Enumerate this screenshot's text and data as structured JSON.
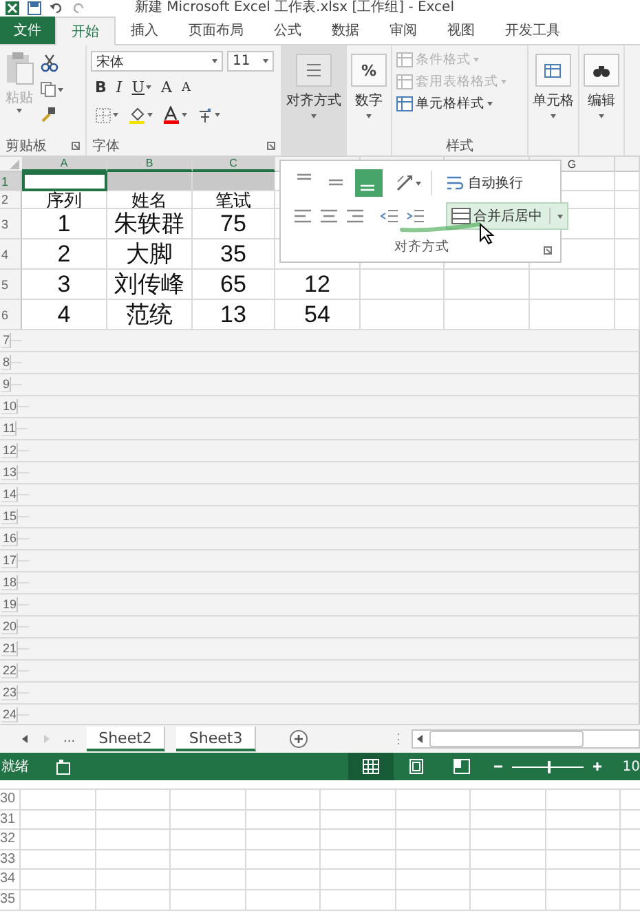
{
  "window": {
    "title": "新建 Microsoft Excel 工作表.xlsx  [工作组] - Excel"
  },
  "ribbon_tabs": [
    {
      "label": "文件",
      "kind": "file",
      "selected": false
    },
    {
      "label": "开始",
      "kind": "tab",
      "selected": true
    },
    {
      "label": "插入",
      "kind": "tab",
      "selected": false
    },
    {
      "label": "页面布局",
      "kind": "tab",
      "selected": false
    },
    {
      "label": "公式",
      "kind": "tab",
      "selected": false
    },
    {
      "label": "数据",
      "kind": "tab",
      "selected": false
    },
    {
      "label": "审阅",
      "kind": "tab",
      "selected": false
    },
    {
      "label": "视图",
      "kind": "tab",
      "selected": false
    },
    {
      "label": "开发工具",
      "kind": "tab",
      "selected": false
    }
  ],
  "ribbon": {
    "clipboard": {
      "paste": {
        "label": "粘贴",
        "disabled": true
      },
      "group_label": "剪贴板"
    },
    "font": {
      "font_name": "宋体",
      "font_size": "11",
      "bold": "B",
      "italic": "I",
      "underline": "U",
      "grow": "A",
      "shrink": "A",
      "group_label": "字体"
    },
    "alignment_button": {
      "label": "对齐方式",
      "expanded": true
    },
    "number_button": {
      "label": "数字",
      "symbol": "%"
    },
    "styles": {
      "items": [
        {
          "label": "条件格式",
          "disabled": true
        },
        {
          "label": "套用表格格式",
          "disabled": true
        },
        {
          "label": "单元格样式",
          "disabled": false
        }
      ],
      "group_label": "样式"
    },
    "cells_button": {
      "label": "单元格"
    },
    "editing_button": {
      "label": "编辑"
    }
  },
  "alignment_panel": {
    "vertical_align": [
      {
        "selected": false
      },
      {
        "selected": false
      },
      {
        "selected": true
      }
    ],
    "wrap_text": "自动换行",
    "merge_center": "合并后居中",
    "group_label": "对齐方式"
  },
  "sheet": {
    "columns": [
      {
        "label": "A",
        "selected": true
      },
      {
        "label": "B",
        "selected": true
      },
      {
        "label": "C",
        "selected": true
      },
      {},
      {},
      {},
      {
        "label": "G",
        "selected": false
      }
    ],
    "rows": [
      {
        "number": "1",
        "selected": true,
        "cells": [
          null,
          null,
          null,
          null,
          null,
          null,
          null
        ]
      },
      {
        "number": "2",
        "selected": false,
        "cells": [
          "序列",
          "姓名",
          "笔试",
          null,
          null,
          null,
          null
        ]
      },
      {
        "number": "3",
        "selected": false,
        "cells": [
          "1",
          "朱轶群",
          "75",
          null,
          null,
          null,
          null
        ]
      },
      {
        "number": "4",
        "selected": false,
        "cells": [
          "2",
          "大脚",
          "35",
          null,
          null,
          null,
          null
        ]
      },
      {
        "number": "5",
        "selected": false,
        "cells": [
          "3",
          "刘传峰",
          "65",
          "12",
          null,
          null,
          null
        ]
      },
      {
        "number": "6",
        "selected": false,
        "cells": [
          "4",
          "范统",
          "13",
          "54",
          null,
          null,
          null
        ]
      },
      {
        "number": "7"
      },
      {
        "number": "8"
      },
      {
        "number": "9"
      },
      {
        "number": "10"
      },
      {
        "number": "11"
      },
      {
        "number": "12"
      },
      {
        "number": "13"
      },
      {
        "number": "14"
      },
      {
        "number": "15"
      },
      {
        "number": "16"
      },
      {
        "number": "17"
      },
      {
        "number": "18"
      },
      {
        "number": "19"
      },
      {
        "number": "20"
      },
      {
        "number": "21"
      },
      {
        "number": "22"
      },
      {
        "number": "23"
      },
      {
        "number": "24"
      }
    ]
  },
  "sheet_tabs": {
    "overflow": "...",
    "tabs": [
      {
        "label": "Sheet2",
        "selected": true
      },
      {
        "label": "Sheet3",
        "selected": true
      }
    ]
  },
  "status_bar": {
    "status": "就绪",
    "views": [
      {
        "kind": "normal",
        "selected": true
      },
      {
        "kind": "page_layout",
        "selected": false
      },
      {
        "kind": "page_break",
        "selected": false
      }
    ],
    "zoom": {
      "level": 0.5,
      "percent": "10"
    }
  },
  "lower_pane": {
    "rows": [
      "30",
      "31",
      "32",
      "33",
      "34",
      "35"
    ]
  }
}
